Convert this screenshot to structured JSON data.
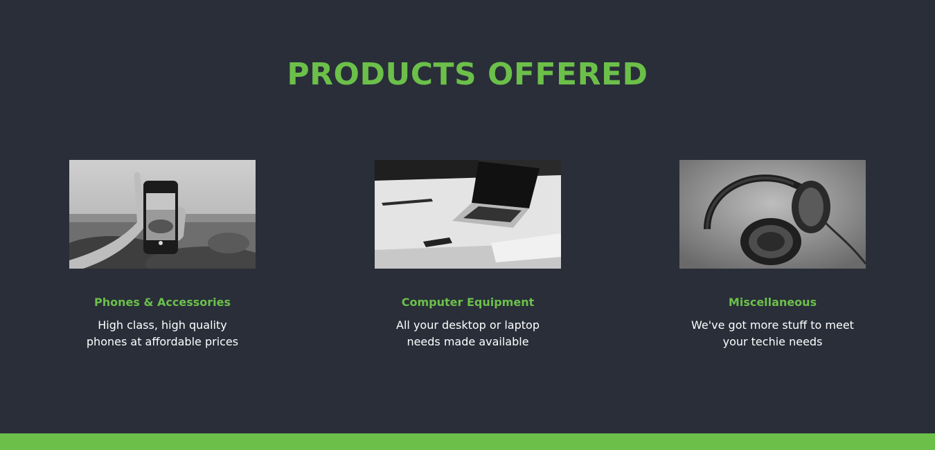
{
  "section": {
    "title": "PRODUCTS OFFERED"
  },
  "products": [
    {
      "name": "Phones & Accessories",
      "description": "High class, high quality phones at affordable prices",
      "image": "phone-in-hand-photo"
    },
    {
      "name": "Computer Equipment",
      "description": "All your desktop or laptop needs made available",
      "image": "laptop-on-desk-photo"
    },
    {
      "name": "Miscellaneous",
      "description": "We've got more stuff to meet your techie needs",
      "image": "headphones-photo"
    }
  ],
  "colors": {
    "background": "#292e39",
    "accent": "#6cc04a",
    "text": "#ffffff"
  }
}
